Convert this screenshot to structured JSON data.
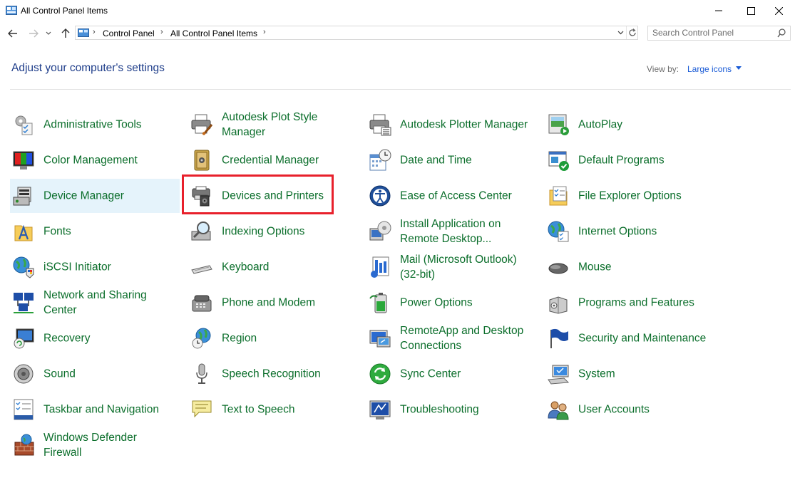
{
  "window": {
    "title": "All Control Panel Items"
  },
  "address": {
    "crumbs": [
      "Control Panel",
      "All Control Panel Items"
    ],
    "search_placeholder": "Search Control Panel"
  },
  "header": {
    "heading": "Adjust your computer's settings",
    "view_by_label": "View by:",
    "view_by_value": "Large icons"
  },
  "items": [
    {
      "label": "Administrative Tools",
      "icon": "admin-tools-icon"
    },
    {
      "label": "Autodesk Plot Style Manager",
      "icon": "printer-brush-icon"
    },
    {
      "label": "Autodesk Plotter Manager",
      "icon": "plotter-icon"
    },
    {
      "label": "AutoPlay",
      "icon": "autoplay-icon"
    },
    {
      "label": "Color Management",
      "icon": "color-management-icon"
    },
    {
      "label": "Credential Manager",
      "icon": "credential-vault-icon"
    },
    {
      "label": "Date and Time",
      "icon": "calendar-clock-icon"
    },
    {
      "label": "Default Programs",
      "icon": "default-programs-icon"
    },
    {
      "label": "Device Manager",
      "icon": "device-manager-icon"
    },
    {
      "label": "Devices and Printers",
      "icon": "devices-printers-icon"
    },
    {
      "label": "Ease of Access Center",
      "icon": "ease-of-access-icon"
    },
    {
      "label": "File Explorer Options",
      "icon": "folder-options-icon"
    },
    {
      "label": "Fonts",
      "icon": "fonts-folder-icon"
    },
    {
      "label": "Indexing Options",
      "icon": "indexing-magnifier-icon"
    },
    {
      "label": "Install Application on Remote Desktop...",
      "icon": "remote-install-icon"
    },
    {
      "label": "Internet Options",
      "icon": "internet-options-icon"
    },
    {
      "label": "iSCSI Initiator",
      "icon": "iscsi-globe-icon"
    },
    {
      "label": "Keyboard",
      "icon": "keyboard-icon"
    },
    {
      "label": "Mail (Microsoft Outlook) (32-bit)",
      "icon": "mail-icon"
    },
    {
      "label": "Mouse",
      "icon": "mouse-icon"
    },
    {
      "label": "Network and Sharing Center",
      "icon": "network-icon"
    },
    {
      "label": "Phone and Modem",
      "icon": "phone-modem-icon"
    },
    {
      "label": "Power Options",
      "icon": "battery-icon"
    },
    {
      "label": "Programs and Features",
      "icon": "programs-box-icon"
    },
    {
      "label": "Recovery",
      "icon": "recovery-icon"
    },
    {
      "label": "Region",
      "icon": "region-globe-clock-icon"
    },
    {
      "label": "RemoteApp and Desktop Connections",
      "icon": "remoteapp-icon"
    },
    {
      "label": "Security and Maintenance",
      "icon": "flag-icon"
    },
    {
      "label": "Sound",
      "icon": "speaker-icon"
    },
    {
      "label": "Speech Recognition",
      "icon": "microphone-icon"
    },
    {
      "label": "Sync Center",
      "icon": "sync-icon"
    },
    {
      "label": "System",
      "icon": "system-computer-icon"
    },
    {
      "label": "Taskbar and Navigation",
      "icon": "taskbar-icon"
    },
    {
      "label": "Text to Speech",
      "icon": "speech-bubble-icon"
    },
    {
      "label": "Troubleshooting",
      "icon": "troubleshooting-icon"
    },
    {
      "label": "User Accounts",
      "icon": "user-accounts-icon"
    },
    {
      "label": "Windows Defender Firewall",
      "icon": "firewall-icon"
    }
  ],
  "colors": {
    "link_green": "#0b6e2b",
    "heading_blue": "#1e3d8a",
    "highlight_red": "#e8202b",
    "hover_bg": "#e5f3fb"
  }
}
